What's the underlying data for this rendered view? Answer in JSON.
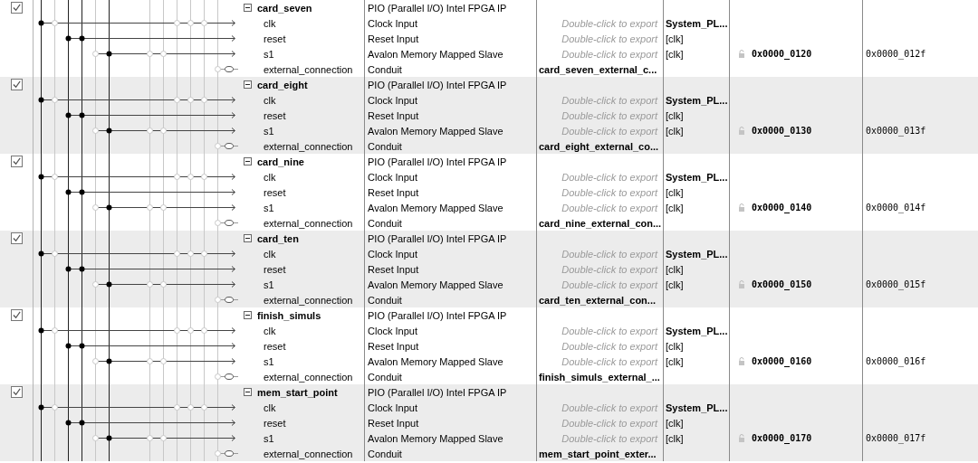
{
  "components": [
    {
      "enabled": true,
      "expanded": true,
      "name": "card_seven",
      "description": "PIO (Parallel I/O) Intel FPGA IP",
      "interfaces": [
        {
          "kind": "clock",
          "name": "clk",
          "description": "Clock Input",
          "export": "Double-click to export",
          "exported": false,
          "clock": "System_PL..."
        },
        {
          "kind": "reset",
          "name": "reset",
          "description": "Reset Input",
          "export": "Double-click to export",
          "exported": false,
          "clock": "[clk]"
        },
        {
          "kind": "slave",
          "name": "s1",
          "description": "Avalon Memory Mapped Slave",
          "export": "Double-click to export",
          "exported": false,
          "clock": "[clk]",
          "base": "0x0000_0120",
          "end": "0x0000_012f"
        },
        {
          "kind": "conduit",
          "name": "external_connection",
          "description": "Conduit",
          "export": "card_seven_external_c...",
          "exported": true
        }
      ]
    },
    {
      "enabled": true,
      "expanded": true,
      "name": "card_eight",
      "description": "PIO (Parallel I/O) Intel FPGA IP",
      "interfaces": [
        {
          "kind": "clock",
          "name": "clk",
          "description": "Clock Input",
          "export": "Double-click to export",
          "exported": false,
          "clock": "System_PL..."
        },
        {
          "kind": "reset",
          "name": "reset",
          "description": "Reset Input",
          "export": "Double-click to export",
          "exported": false,
          "clock": "[clk]"
        },
        {
          "kind": "slave",
          "name": "s1",
          "description": "Avalon Memory Mapped Slave",
          "export": "Double-click to export",
          "exported": false,
          "clock": "[clk]",
          "base": "0x0000_0130",
          "end": "0x0000_013f"
        },
        {
          "kind": "conduit",
          "name": "external_connection",
          "description": "Conduit",
          "export": "card_eight_external_co...",
          "exported": true
        }
      ]
    },
    {
      "enabled": true,
      "expanded": true,
      "name": "card_nine",
      "description": "PIO (Parallel I/O) Intel FPGA IP",
      "interfaces": [
        {
          "kind": "clock",
          "name": "clk",
          "description": "Clock Input",
          "export": "Double-click to export",
          "exported": false,
          "clock": "System_PL..."
        },
        {
          "kind": "reset",
          "name": "reset",
          "description": "Reset Input",
          "export": "Double-click to export",
          "exported": false,
          "clock": "[clk]"
        },
        {
          "kind": "slave",
          "name": "s1",
          "description": "Avalon Memory Mapped Slave",
          "export": "Double-click to export",
          "exported": false,
          "clock": "[clk]",
          "base": "0x0000_0140",
          "end": "0x0000_014f"
        },
        {
          "kind": "conduit",
          "name": "external_connection",
          "description": "Conduit",
          "export": "card_nine_external_con...",
          "exported": true
        }
      ]
    },
    {
      "enabled": true,
      "expanded": true,
      "name": "card_ten",
      "description": "PIO (Parallel I/O) Intel FPGA IP",
      "interfaces": [
        {
          "kind": "clock",
          "name": "clk",
          "description": "Clock Input",
          "export": "Double-click to export",
          "exported": false,
          "clock": "System_PL..."
        },
        {
          "kind": "reset",
          "name": "reset",
          "description": "Reset Input",
          "export": "Double-click to export",
          "exported": false,
          "clock": "[clk]"
        },
        {
          "kind": "slave",
          "name": "s1",
          "description": "Avalon Memory Mapped Slave",
          "export": "Double-click to export",
          "exported": false,
          "clock": "[clk]",
          "base": "0x0000_0150",
          "end": "0x0000_015f"
        },
        {
          "kind": "conduit",
          "name": "external_connection",
          "description": "Conduit",
          "export": "card_ten_external_con...",
          "exported": true
        }
      ]
    },
    {
      "enabled": true,
      "expanded": true,
      "name": "finish_simuls",
      "description": "PIO (Parallel I/O) Intel FPGA IP",
      "interfaces": [
        {
          "kind": "clock",
          "name": "clk",
          "description": "Clock Input",
          "export": "Double-click to export",
          "exported": false,
          "clock": "System_PL..."
        },
        {
          "kind": "reset",
          "name": "reset",
          "description": "Reset Input",
          "export": "Double-click to export",
          "exported": false,
          "clock": "[clk]"
        },
        {
          "kind": "slave",
          "name": "s1",
          "description": "Avalon Memory Mapped Slave",
          "export": "Double-click to export",
          "exported": false,
          "clock": "[clk]",
          "base": "0x0000_0160",
          "end": "0x0000_016f"
        },
        {
          "kind": "conduit",
          "name": "external_connection",
          "description": "Conduit",
          "export": "finish_simuls_external_...",
          "exported": true
        }
      ]
    },
    {
      "enabled": true,
      "expanded": true,
      "name": "mem_start_point",
      "description": "PIO (Parallel I/O) Intel FPGA IP",
      "interfaces": [
        {
          "kind": "clock",
          "name": "clk",
          "description": "Clock Input",
          "export": "Double-click to export",
          "exported": false,
          "clock": "System_PL..."
        },
        {
          "kind": "reset",
          "name": "reset",
          "description": "Reset Input",
          "export": "Double-click to export",
          "exported": false,
          "clock": "[clk]"
        },
        {
          "kind": "slave",
          "name": "s1",
          "description": "Avalon Memory Mapped Slave",
          "export": "Double-click to export",
          "exported": false,
          "clock": "[clk]",
          "base": "0x0000_0170",
          "end": "0x0000_017f"
        },
        {
          "kind": "conduit",
          "name": "external_connection",
          "description": "Conduit",
          "export": "mem_start_point_exter...",
          "exported": true
        }
      ]
    }
  ]
}
